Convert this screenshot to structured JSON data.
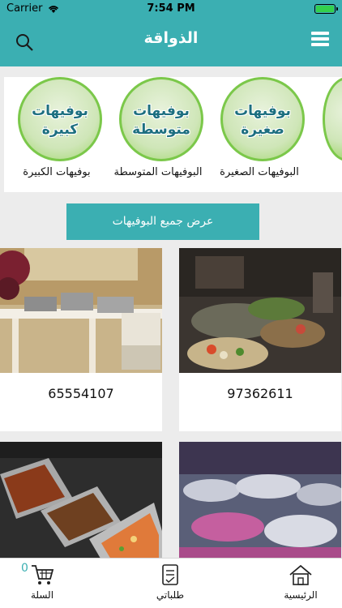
{
  "status_bar": {
    "carrier": "Carrier",
    "time": "7:54 PM"
  },
  "header": {
    "title": "الذواقة"
  },
  "categories": [
    {
      "circle_line1": "بوفيهات",
      "circle_line2": "كبيرة",
      "label": "بوفيهات الكبيرة"
    },
    {
      "circle_line1": "بوفيهات",
      "circle_line2": "متوسطة",
      "label": "البوفيهات المتوسطة"
    },
    {
      "circle_line1": "بوفيهات",
      "circle_line2": "صغيرة",
      "label": "البوفيهات الصغيرة"
    }
  ],
  "show_all_label": "عرض جميع البوفيهات",
  "products": [
    {
      "phone": "97362611"
    },
    {
      "phone": "65554107"
    },
    {
      "phone": ""
    },
    {
      "phone": ""
    }
  ],
  "tabbar": {
    "home_label": "الرئيسية",
    "orders_label": "طلباتي",
    "cart_label": "السلة",
    "cart_count": "0"
  }
}
